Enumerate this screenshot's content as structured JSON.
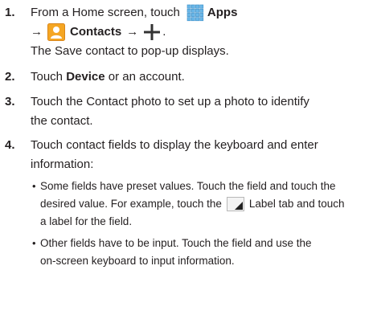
{
  "steps": [
    {
      "number": "1.",
      "line1_prefix": "From a Home screen, touch",
      "line1_bold": "Apps",
      "line2_bold": "Contacts",
      "arrow": "→",
      "period": ".",
      "line3": "The Save contact to pop-up displays."
    },
    {
      "number": "2.",
      "prefix": "Touch ",
      "bold": "Device",
      "suffix": " or an account."
    },
    {
      "number": "3.",
      "line1": "Touch the Contact photo to set up a photo to identify",
      "line2": "the contact."
    },
    {
      "number": "4.",
      "line1": "Touch contact fields to display the keyboard and enter",
      "line2": "information:",
      "bullets": [
        {
          "line1": "Some fields have preset values. Touch the field and touch the",
          "line2_prefix": "desired value. For example, touch the",
          "line2_suffix": "Label tab and touch",
          "line3": "a label for the field."
        },
        {
          "line1": "Other fields have to be input. Touch the field and use the",
          "line2": "on-screen keyboard to input information."
        }
      ]
    }
  ],
  "bullet_char": "•",
  "icons": {
    "apps": "apps-grid-icon",
    "contacts": "contacts-icon",
    "add": "add-plus-icon",
    "label_tab": "label-tab-icon"
  },
  "colors": {
    "text": "#231f20",
    "apps_icon": "#6ab7e8",
    "contacts_icon": "#f5a623",
    "label_tab": "#222222"
  }
}
